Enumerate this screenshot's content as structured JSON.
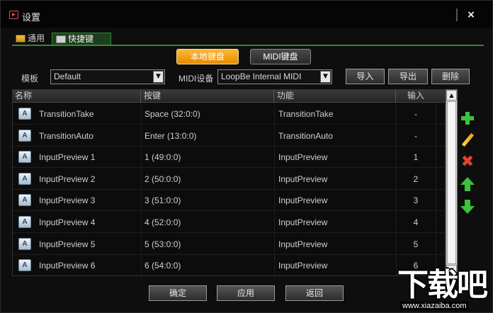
{
  "window": {
    "title": "设置",
    "close_label": "×"
  },
  "tabs": [
    {
      "label": "通用"
    },
    {
      "label": "快捷键",
      "active": true
    }
  ],
  "mode_buttons": {
    "local": "本地键盘",
    "midi": "MIDI键盘",
    "selected": "local"
  },
  "template": {
    "label": "模板",
    "value": "Default"
  },
  "midi_device": {
    "label": "MIDI设备",
    "value": "LoopBe Internal MIDI"
  },
  "actions": {
    "import": "导入",
    "export": "导出",
    "delete": "删除"
  },
  "table": {
    "columns": {
      "name": "名称",
      "key": "按键",
      "function": "功能",
      "input": "输入"
    },
    "rows": [
      {
        "name": "TransitionTake",
        "key": "Space (32:0:0)",
        "function": "TransitionTake",
        "input": "-"
      },
      {
        "name": "TransitionAuto",
        "key": "Enter (13:0:0)",
        "function": "TransitionAuto",
        "input": "-"
      },
      {
        "name": "InputPreview 1",
        "key": "1 (49:0:0)",
        "function": "InputPreview",
        "input": "1"
      },
      {
        "name": "InputPreview 2",
        "key": "2 (50:0:0)",
        "function": "InputPreview",
        "input": "2"
      },
      {
        "name": "InputPreview 3",
        "key": "3 (51:0:0)",
        "function": "InputPreview",
        "input": "3"
      },
      {
        "name": "InputPreview 4",
        "key": "4 (52:0:0)",
        "function": "InputPreview",
        "input": "4"
      },
      {
        "name": "InputPreview 5",
        "key": "5 (53:0:0)",
        "function": "InputPreview",
        "input": "5"
      },
      {
        "name": "InputPreview 6",
        "key": "6 (54:0:0)",
        "function": "InputPreview",
        "input": "6"
      }
    ],
    "row_icon": "A"
  },
  "tools": [
    "add-icon",
    "edit-icon",
    "remove-icon",
    "move-up-icon",
    "move-down-icon"
  ],
  "footer": {
    "ok": "确定",
    "apply": "应用",
    "back": "返回"
  },
  "watermark": {
    "text": "下载吧",
    "url": "www.xiazaiba.com"
  },
  "colors": {
    "accent_orange": "#f5a000",
    "tab_green": "#2e8a2e",
    "add_green": "#3cc23c",
    "remove_red": "#e0452d"
  }
}
